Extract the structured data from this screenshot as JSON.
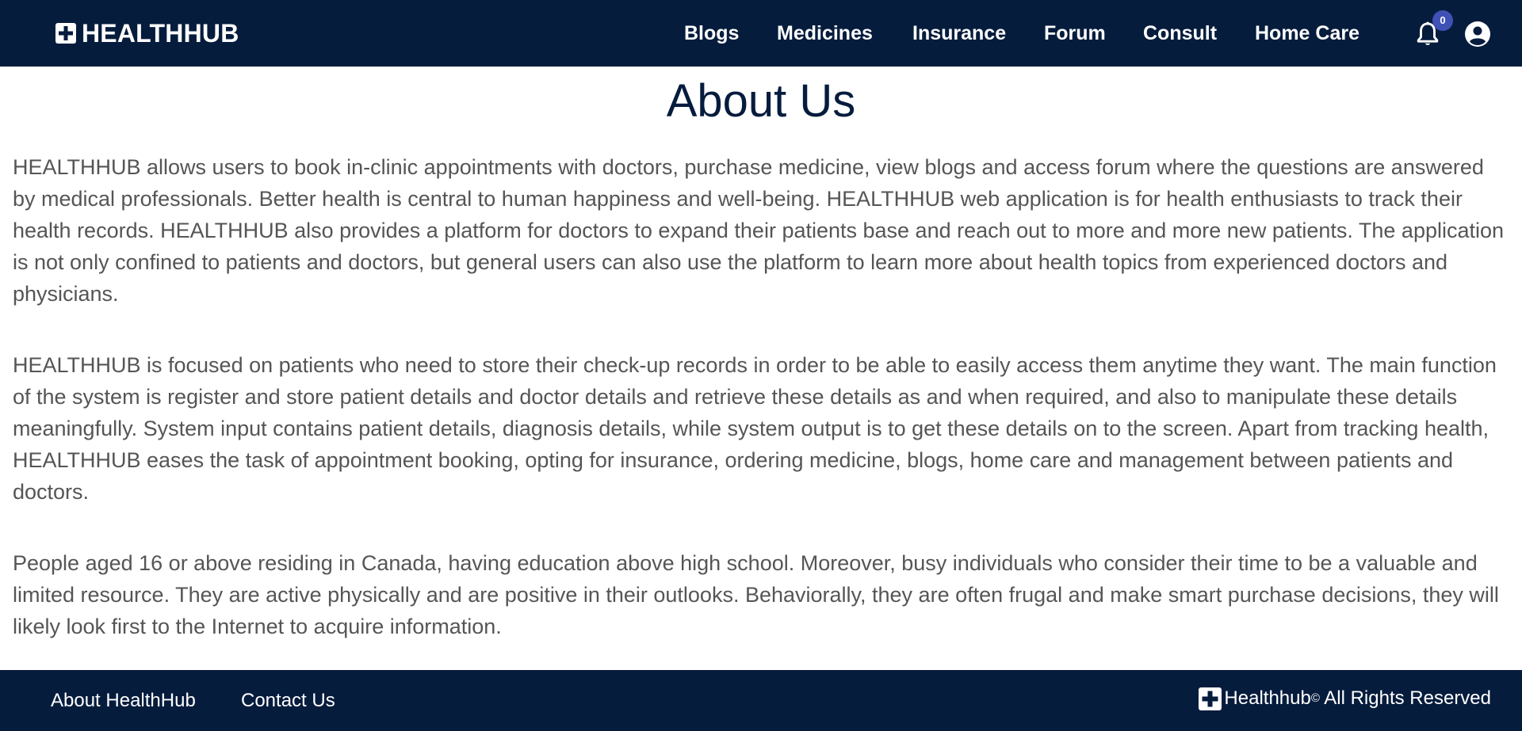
{
  "header": {
    "brand": "HEALTHHUB",
    "nav": [
      "Blogs",
      "Medicines",
      "Insurance",
      "Forum",
      "Consult",
      "Home Care"
    ],
    "notification_count": "0"
  },
  "main": {
    "title": "About Us",
    "paragraphs": [
      "HEALTHHUB allows users to book in-clinic appointments with doctors, purchase medicine, view blogs and access forum where the questions are answered by medical professionals. Better health is central to human happiness and well-being. HEALTHHUB web application is for health enthusiasts to track their health records. HEALTHHUB also provides a platform for doctors to expand their patients base and reach out to more and more new patients. The application is not only confined to patients and doctors, but general users can also use the platform to learn more about health topics from experienced doctors and physicians.",
      "HEALTHHUB is focused on patients who need to store their check-up records in order to be able to easily access them anytime they want. The main function of the system is register and store patient details and doctor details and retrieve these details as and when required, and also to manipulate these details meaningfully. System input contains patient details, diagnosis details, while system output is to get these details on to the screen. Apart from tracking health, HEALTHHUB eases the task of appointment booking, opting for insurance, ordering medicine, blogs, home care and management between patients and doctors.",
      "People aged 16 or above residing in Canada, having education above high school. Moreover, busy individuals who consider their time to be a valuable and limited resource. They are active physically and are positive in their outlooks. Behaviorally, they are often frugal and make smart purchase decisions, they will likely look first to the Internet to acquire information."
    ]
  },
  "footer": {
    "links": [
      "About HealthHub",
      "Contact Us"
    ],
    "brand": "Healthhub",
    "copyright_symbol": "©",
    "rights": " All Rights Reserved"
  },
  "colors": {
    "navy": "#061c3d",
    "badge": "#3f51b5",
    "body_text": "#555555"
  },
  "icons": {
    "brand": "medical-cross-icon",
    "notifications": "bell-icon",
    "account": "user-circle-icon"
  }
}
